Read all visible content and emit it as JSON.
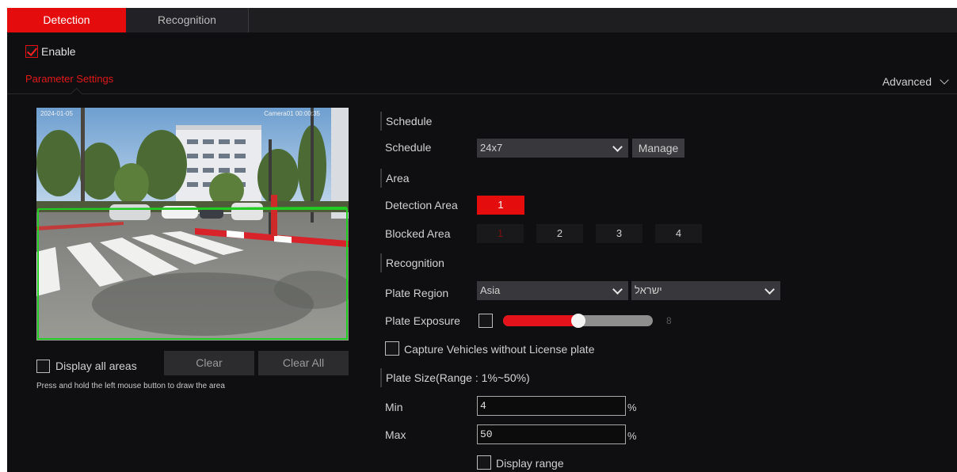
{
  "tabs": [
    {
      "label": "Detection",
      "active": true
    },
    {
      "label": "Recognition",
      "active": false
    }
  ],
  "enable": {
    "label": "Enable",
    "checked": true
  },
  "parameter_settings_label": "Parameter Settings",
  "advanced_label": "Advanced",
  "camera": {
    "timestamp_left": "2024-01-05",
    "timestamp_right": "Camera01 00:00:35"
  },
  "display_all_areas": {
    "label": "Display all areas",
    "checked": false
  },
  "buttons": {
    "clear": "Clear",
    "clear_all": "Clear All"
  },
  "hint": "Press and hold the left mouse button to draw the area",
  "schedule_section": {
    "title": "Schedule",
    "schedule_label": "Schedule",
    "schedule_value": "24x7",
    "manage_label": "Manage"
  },
  "area_section": {
    "title": "Area",
    "detection_area_label": "Detection Area",
    "detection_areas": [
      "1"
    ],
    "blocked_area_label": "Blocked Area",
    "blocked_areas": [
      "1",
      "2",
      "3",
      "4"
    ]
  },
  "recognition_section": {
    "title": "Recognition",
    "plate_region_label": "Plate Region",
    "plate_region_value": "Asia",
    "plate_country_value": "ישראל",
    "plate_exposure_label": "Plate Exposure",
    "plate_exposure_checked": false,
    "plate_exposure_value": "8",
    "plate_exposure_fraction": 0.5,
    "capture_without_plate_label": "Capture Vehicles without License plate",
    "capture_without_plate_checked": false
  },
  "plate_size_section": {
    "title": "Plate Size(Range : 1%~50%)",
    "min_label": "Min",
    "min_value": "4",
    "max_label": "Max",
    "max_value": "50",
    "percent_sign": "%",
    "display_range_label": "Display range",
    "display_range_checked": false
  },
  "colors": {
    "accent": "#e40c0c",
    "background": "#0f0f11",
    "detection_line": "#22cc22"
  }
}
